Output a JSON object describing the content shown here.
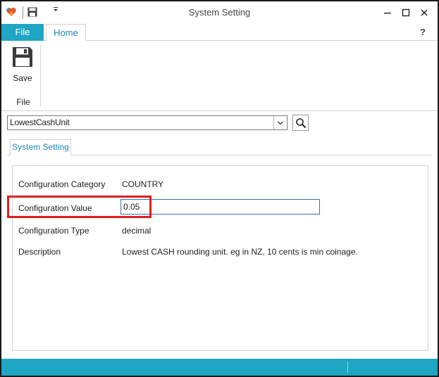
{
  "window": {
    "title": "System Setting"
  },
  "ribbon": {
    "tabs": [
      {
        "label": "File"
      },
      {
        "label": "Home"
      }
    ],
    "help_label": "?",
    "save_label": "Save",
    "group_label": "File"
  },
  "search": {
    "selected_value": "LowestCashUnit"
  },
  "content_tab": {
    "label": "System Setting"
  },
  "fields": {
    "category": {
      "label": "Configuration Category",
      "value": "COUNTRY"
    },
    "value": {
      "label": "Configuration Value",
      "value": "0.05"
    },
    "type": {
      "label": "Configuration Type",
      "value": "decimal"
    },
    "description": {
      "label": "Description",
      "value": "Lowest CASH rounding unit. eg in NZ, 10 cents is min coinage."
    }
  },
  "colors": {
    "accent": "#1fa6c4",
    "tab_text": "#1f87b2",
    "highlight": "#e01e1e"
  },
  "icons": {
    "app": "app-logo-icon",
    "qat_save": "floppy-disk-icon",
    "qat_dropdown": "chevron-down-icon",
    "ribbon_save": "floppy-disk-icon",
    "combo_arrow": "chevron-down-icon",
    "search": "search-icon",
    "minimize": "minimize-icon",
    "maximize": "maximize-icon",
    "close": "close-icon"
  }
}
